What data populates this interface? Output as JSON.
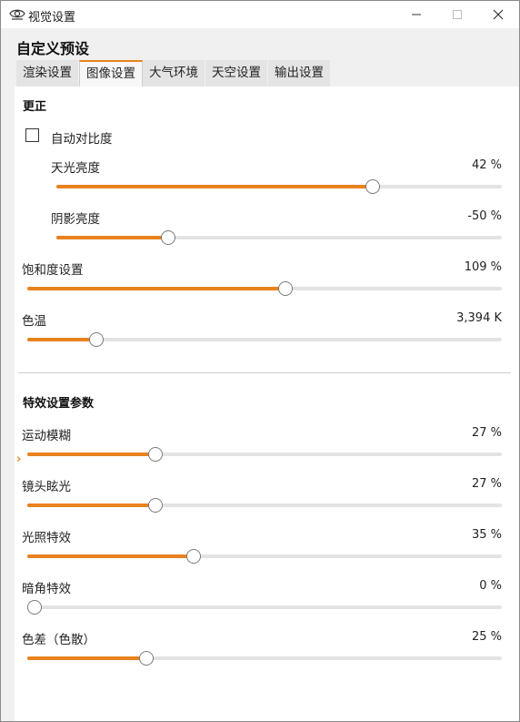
{
  "window": {
    "title": "视觉设置",
    "icon": "eye-icon"
  },
  "header": {
    "preset_title": "自定义预设",
    "tabs": [
      {
        "label": "渲染设置",
        "active": false
      },
      {
        "label": "图像设置",
        "active": true
      },
      {
        "label": "大气环境",
        "active": false
      },
      {
        "label": "天空设置",
        "active": false
      },
      {
        "label": "输出设置",
        "active": false
      }
    ]
  },
  "colors": {
    "accent": "#e8821e",
    "track": "#e3e3e3"
  },
  "correction": {
    "title": "更正",
    "auto_contrast": {
      "label": "自动对比度",
      "checked": false
    },
    "sliders": [
      {
        "label": "天光亮度",
        "value": "42 %",
        "fraction": 0.71
      },
      {
        "label": "阴影亮度",
        "value": "-50 %",
        "fraction": 0.25
      },
      {
        "label": "饱和度设置",
        "value": "109 %",
        "fraction": 0.545
      },
      {
        "label": "色温",
        "value": "3,394 K",
        "fraction": 0.145
      }
    ]
  },
  "effects": {
    "title": "特效设置参数",
    "sliders": [
      {
        "label": "运动模糊",
        "value": "27 %",
        "fraction": 0.27
      },
      {
        "label": "镜头眩光",
        "value": "27 %",
        "fraction": 0.27
      },
      {
        "label": "光照特效",
        "value": "35 %",
        "fraction": 0.35
      },
      {
        "label": "暗角特效",
        "value": "0 %",
        "fraction": 0.0
      },
      {
        "label": "色差（色散）",
        "value": "25 %",
        "fraction": 0.25
      }
    ]
  }
}
